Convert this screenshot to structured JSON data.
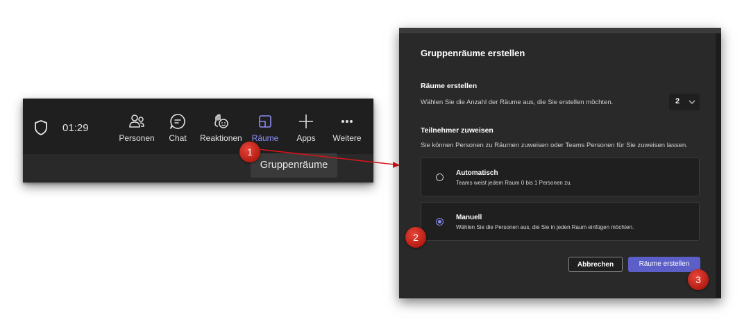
{
  "toolbar": {
    "timer": "01:29",
    "items": [
      {
        "label": "Personen",
        "icon": "people-icon"
      },
      {
        "label": "Chat",
        "icon": "chat-icon"
      },
      {
        "label": "Reaktionen",
        "icon": "reactions-icon"
      },
      {
        "label": "Räume",
        "icon": "breakout-rooms-icon",
        "active": true
      },
      {
        "label": "Apps",
        "icon": "plus-icon"
      },
      {
        "label": "Weitere",
        "icon": "more-icon"
      }
    ],
    "tooltip": "Gruppenräume"
  },
  "badges": [
    "1",
    "2",
    "3"
  ],
  "dialog": {
    "title": "Gruppenräume erstellen",
    "rooms_label": "Räume erstellen",
    "rooms_desc": "Wählen Sie die Anzahl der Räume aus, die Sie erstellen möchten.",
    "room_count": "2",
    "assign_label": "Teilnehmer zuweisen",
    "assign_desc": "Sie können Personen zu Räumen zuweisen oder Teams Personen für Sie zuweisen lassen.",
    "options": [
      {
        "title": "Automatisch",
        "desc": "Teams weist jedem Raum 0 bis 1 Personen zu.",
        "selected": false
      },
      {
        "title": "Manuell",
        "desc": "Wählen Sie die Personen aus, die Sie in jeden Raum einfügen möchten.",
        "selected": true
      }
    ],
    "cancel_label": "Abbrechen",
    "create_label": "Räume erstellen"
  },
  "colors": {
    "accent": "#5b5fc7",
    "active_icon": "#8b8cf2",
    "badge": "#c8241a",
    "arrow": "#d9141a"
  }
}
